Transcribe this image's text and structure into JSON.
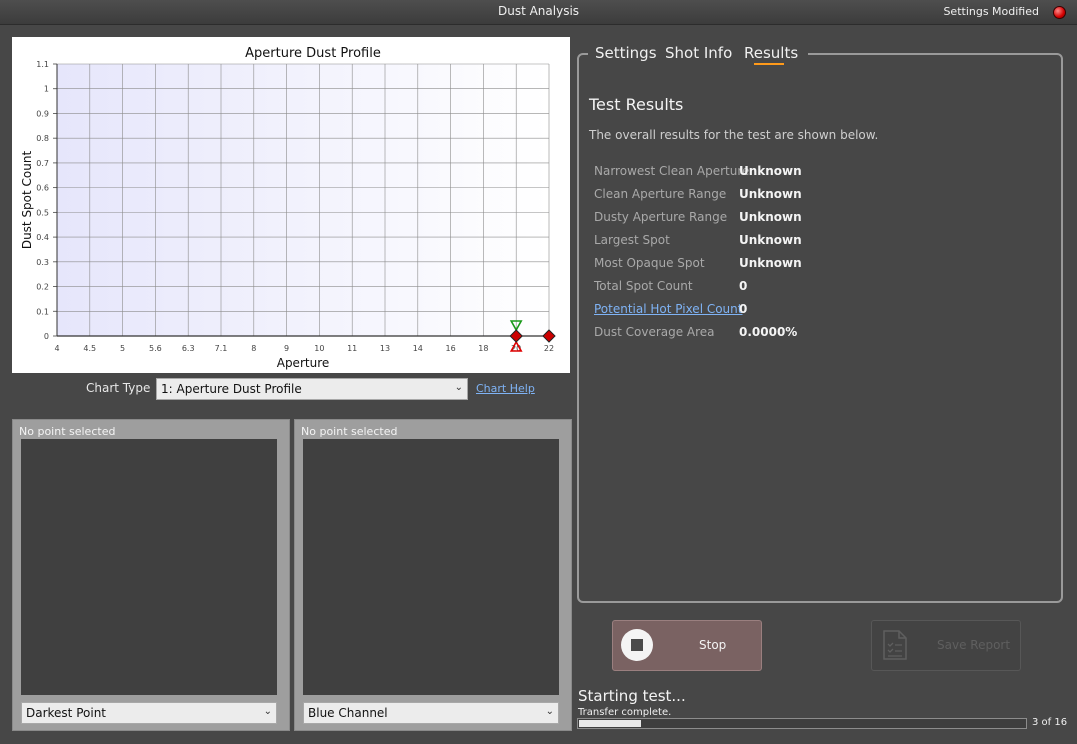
{
  "window": {
    "title": "Dust Analysis",
    "settings_modified": "Settings Modified",
    "led_color": "#d40000"
  },
  "chart_data": {
    "type": "scatter",
    "title": "Aperture Dust Profile",
    "xlabel": "Aperture",
    "ylabel": "Dust Spot Count",
    "x_ticks": [
      "4",
      "4.5",
      "5",
      "5.6",
      "6.3",
      "7.1",
      "8",
      "9",
      "10",
      "11",
      "13",
      "14",
      "16",
      "18",
      "20",
      "22"
    ],
    "y_ticks": [
      "0",
      "0.1",
      "0.2",
      "0.3",
      "0.4",
      "0.5",
      "0.6",
      "0.7",
      "0.8",
      "0.9",
      "1",
      "1.1"
    ],
    "ylim": [
      0,
      1.1
    ],
    "grid": true,
    "points": [
      {
        "x": "20",
        "y": 0,
        "marker": "diamond",
        "color": "#cc0000"
      },
      {
        "x": "22",
        "y": 0,
        "marker": "diamond",
        "color": "#cc0000"
      }
    ],
    "range_markers": {
      "x": "20",
      "upper_marker": "triangle-down",
      "upper_color": "#1a9a1a",
      "lower_marker": "triangle-up",
      "lower_color": "#e00000"
    },
    "background_gradient": [
      "#e6e6fb",
      "#ffffff"
    ]
  },
  "chart_controls": {
    "type_label": "Chart Type",
    "type_value": "1: Aperture Dust Profile",
    "help_link": "Chart Help"
  },
  "previews": [
    {
      "caption": "No point selected",
      "select_value": "Darkest Point"
    },
    {
      "caption": "No point selected",
      "select_value": "Blue Channel"
    }
  ],
  "tabs": [
    {
      "label": "Settings",
      "active": false
    },
    {
      "label": "Shot Info",
      "active": false
    },
    {
      "label": "Results",
      "active": true
    }
  ],
  "results": {
    "title": "Test Results",
    "description": "The overall results for the test are shown below.",
    "rows": [
      {
        "label": "Narrowest Clean Aperture",
        "value": "Unknown",
        "link": false
      },
      {
        "label": "Clean Aperture Range",
        "value": "Unknown",
        "link": false
      },
      {
        "label": "Dusty Aperture Range",
        "value": "Unknown",
        "link": false
      },
      {
        "label": "Largest Spot",
        "value": "Unknown",
        "link": false
      },
      {
        "label": "Most Opaque Spot",
        "value": "Unknown",
        "link": false
      },
      {
        "label": "Total Spot Count",
        "value": "0",
        "link": false
      },
      {
        "label": "Potential Hot Pixel Count",
        "value": "0",
        "link": true
      },
      {
        "label": "Dust Coverage Area",
        "value": "0.0000%",
        "link": false
      }
    ]
  },
  "buttons": {
    "stop": "Stop",
    "save_report": "Save Report"
  },
  "status": {
    "main": "Starting test...",
    "sub": "Transfer complete.",
    "progress_current": 3,
    "progress_total": 16,
    "progress_text": "3 of 16",
    "progress_fraction": 0.14
  },
  "accent_color": "#ff9a1a"
}
